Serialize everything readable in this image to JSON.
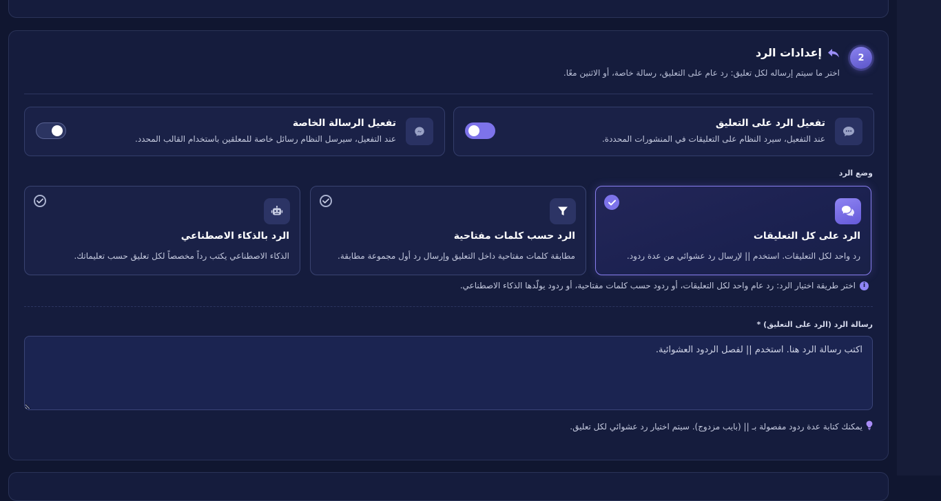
{
  "section": {
    "step_number": "2",
    "title": "إعدادات الرد",
    "subtitle": "اختر ما سيتم إرساله لكل تعليق: رد عام على التعليق، رسالة خاصة، أو الاثنين معًا."
  },
  "toggles": [
    {
      "title": "تفعيل الرد على التعليق",
      "description": "عند التفعيل، سيرد النظام على التعليقات في المنشورات المحددة.",
      "icon": "comment-icon",
      "enabled": true
    },
    {
      "title": "تفعيل الرسالة الخاصة",
      "description": "عند التفعيل، سيرسل النظام رسائل خاصة للمعلقين باستخدام القالب المحدد.",
      "icon": "messenger-icon",
      "enabled": false
    }
  ],
  "reply_mode": {
    "label": "وضع الرد",
    "selected": "all",
    "options": [
      {
        "id": "all",
        "title": "الرد على كل التعليقات",
        "description": "رد واحد لكل التعليقات. استخدم || لإرسال رد عشوائي من عدة ردود.",
        "icon": "comments-icon"
      },
      {
        "id": "keywords",
        "title": "الرد حسب كلمات مفتاحية",
        "description": "مطابقة كلمات مفتاحية داخل التعليق وإرسال رد أول مجموعة مطابقة.",
        "icon": "filter-icon"
      },
      {
        "id": "ai",
        "title": "الرد بالذكاء الاصطناعي",
        "description": "الذكاء الاصطناعي يكتب رداً مخصصاً لكل تعليق حسب تعليماتك.",
        "icon": "robot-icon"
      }
    ],
    "info": "اختر طريقة اختيار الرد: رد عام واحد لكل التعليقات، أو ردود حسب كلمات مفتاحية، أو ردود يولّدها الذكاء الاصطناعي."
  },
  "reply_message": {
    "label": "رسالة الرد (الرد على التعليق) *",
    "placeholder": "اكتب رسالة الرد هنا. استخدم || لفصل الردود العشوائية.",
    "value": "",
    "hint": "يمكنك كتابة عدة ردود مفصولة بـ || (بايب مزدوج). سيتم اختيار رد عشوائي لكل تعليق."
  },
  "colors": {
    "accent": "#7d73ea",
    "background": "#101630",
    "card": "#151c3d"
  }
}
